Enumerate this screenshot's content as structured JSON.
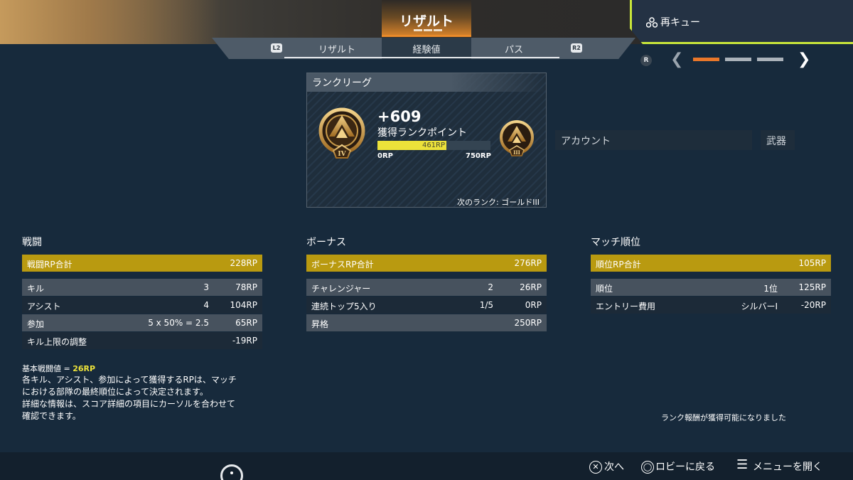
{
  "header": {
    "title": "リザルト",
    "requeue_label": "再キュー",
    "tabs": [
      {
        "label": "リザルト",
        "active": false
      },
      {
        "label": "経験値",
        "active": true
      },
      {
        "label": "パス",
        "active": false
      }
    ],
    "left_bumper": "L2",
    "right_bumper": "R2",
    "right_stick": "R",
    "page_indicator": {
      "pages": 3,
      "current": 1
    },
    "accent_color": "#e98a2a",
    "requeue_border_color": "#c8e63a"
  },
  "rank_card": {
    "title": "ランクリーグ",
    "points_gained": "+609",
    "points_label": "獲得ランクポイント",
    "progress_fraction": 0.61,
    "progress_text": "461RP",
    "min_label": "0RP",
    "max_label": "750RP",
    "current_tier_numeral": "IV",
    "next_tier_numeral": "III",
    "next_rank_label": "次のランク: ゴールドIII",
    "progress_color": "#ece23a"
  },
  "side_tabs": {
    "account": "アカウント",
    "weapon": "武器"
  },
  "columns": {
    "combat": {
      "title": "戦闘",
      "total_label": "戦闘RP合計",
      "total_value": "228RP",
      "rows": [
        {
          "label": "キル",
          "mid": "3",
          "value": "78RP"
        },
        {
          "label": "アシスト",
          "mid": "4",
          "value": "104RP"
        },
        {
          "label": "参加",
          "mid": "5 x 50% = 2.5",
          "value": "65RP"
        },
        {
          "label": "キル上限の調整",
          "mid": "",
          "value": "-19RP"
        }
      ]
    },
    "bonus": {
      "title": "ボーナス",
      "total_label": "ボーナスRP合計",
      "total_value": "276RP",
      "rows": [
        {
          "label": "チャレンジャー",
          "mid": "2",
          "value": "26RP"
        },
        {
          "label": "連続トップ5入り",
          "mid": "1/5",
          "value": "0RP"
        },
        {
          "label": "昇格",
          "mid": "",
          "value": "250RP"
        }
      ]
    },
    "placement": {
      "title": "マッチ順位",
      "total_label": "順位RP合計",
      "total_value": "105RP",
      "rows": [
        {
          "label": "順位",
          "mid": "1位",
          "value": "125RP"
        },
        {
          "label": "エントリー費用",
          "mid": "シルバーI",
          "value": "-20RP"
        }
      ]
    }
  },
  "base_combat": {
    "label": "基本戦闘値 = ",
    "value": "26RP"
  },
  "description": [
    "各キル、アシスト、参加によって獲得するRPは、マッチ",
    "における部隊の最終順位によって決定されます。",
    "詳細な情報は、スコア詳細の項目にカーソルを合わせて",
    "確認できます。"
  ],
  "reward_note": "ランク報酬が獲得可能になりました",
  "footer": {
    "next": {
      "icon": "✕",
      "label": "次へ"
    },
    "lobby": {
      "icon": "◯",
      "label": "ロビーに戻る"
    },
    "menu": {
      "icon": "☰",
      "label": "メニューを開く"
    }
  }
}
